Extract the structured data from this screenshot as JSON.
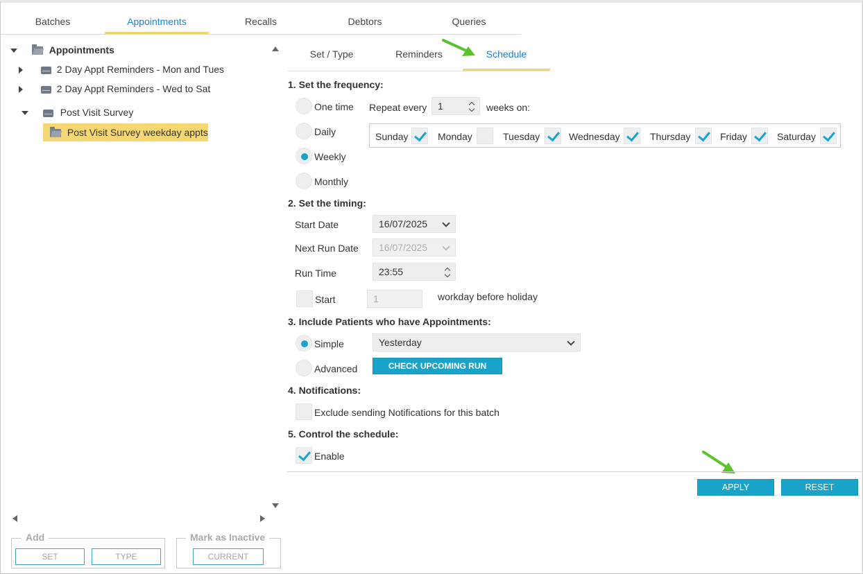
{
  "top_tabs": [
    "Batches",
    "Appointments",
    "Recalls",
    "Debtors",
    "Queries"
  ],
  "tree": {
    "root": "Appointments",
    "items": [
      "2 Day Appt Reminders - Mon and Tues",
      "2 Day Appt Reminders - Wed to Sat",
      "Post Visit Survey"
    ],
    "child": "Post Visit Survey weekday appts"
  },
  "sub_tabs": [
    "Set / Type",
    "Reminders",
    "Schedule"
  ],
  "frequency": {
    "title": "1. Set the frequency:",
    "options": [
      "One time",
      "Daily",
      "Weekly",
      "Monthly"
    ],
    "selected": "Weekly",
    "repeat_label": "Repeat every",
    "repeat_value": "1",
    "weeks_on_label": "weeks on:",
    "days": [
      {
        "name": "Sunday",
        "checked": true
      },
      {
        "name": "Monday",
        "checked": false
      },
      {
        "name": "Tuesday",
        "checked": true
      },
      {
        "name": "Wednesday",
        "checked": true
      },
      {
        "name": "Thursday",
        "checked": true
      },
      {
        "name": "Friday",
        "checked": true
      },
      {
        "name": "Saturday",
        "checked": true
      }
    ]
  },
  "timing": {
    "title": "2. Set the timing:",
    "start_date_label": "Start Date",
    "start_date": "16/07/2025",
    "next_run_label": "Next Run Date",
    "next_run": "16/07/2025",
    "run_time_label": "Run Time",
    "run_time": "23:55",
    "start_label": "Start",
    "start_value": "1",
    "workday_label": "workday before holiday"
  },
  "include": {
    "title": "3. Include Patients who have Appointments:",
    "simple_label": "Simple",
    "simple_value": "Yesterday",
    "advanced_label": "Advanced",
    "check_button": "CHECK UPCOMING RUN DATES"
  },
  "notifications": {
    "title": "4. Notifications:",
    "exclude_label": "Exclude sending Notifications for this batch"
  },
  "control": {
    "title": "5. Control the schedule:",
    "enable_label": "Enable"
  },
  "actions": {
    "apply": "APPLY CHANGES",
    "reset": "RESET CHANGES"
  },
  "bottom": {
    "add_legend": "Add",
    "set_button": "SET",
    "type_button": "TYPE",
    "inactive_legend": "Mark as Inactive",
    "current_button": "CURRENT"
  },
  "colors": {
    "accent": "#1aa3c9",
    "tab_active": "#1a7fd1",
    "tab_underline": "#f3d36b",
    "tree_selected": "#f7d774",
    "annotation_arrow": "#5bc42b"
  }
}
